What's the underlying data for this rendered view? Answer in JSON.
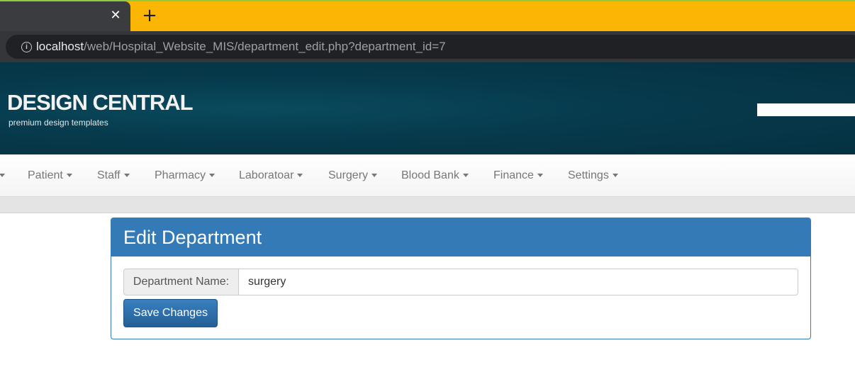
{
  "browser": {
    "tab_close_glyph": "✕",
    "new_tab_glyph": "+",
    "url_host": "localhost",
    "url_path": "/web/Hospital_Website_MIS/department_edit.php?department_id=7",
    "info_glyph": "i"
  },
  "header": {
    "logo_title": "DESIGN CENTRAL",
    "logo_subtitle": "premium design templates"
  },
  "nav": {
    "items": [
      {
        "label": "Patient"
      },
      {
        "label": "Staff"
      },
      {
        "label": "Pharmacy"
      },
      {
        "label": "Laboratoar"
      },
      {
        "label": "Surgery"
      },
      {
        "label": "Blood Bank"
      },
      {
        "label": "Finance"
      },
      {
        "label": "Settings"
      }
    ]
  },
  "panel": {
    "title": "Edit Department",
    "field_label": "Department Name:",
    "field_value": "surgery",
    "save_label": "Save Changes"
  },
  "colors": {
    "tab_strip": "#fbb505",
    "header_bg": "#063a4c",
    "panel_primary": "#337ab7"
  }
}
